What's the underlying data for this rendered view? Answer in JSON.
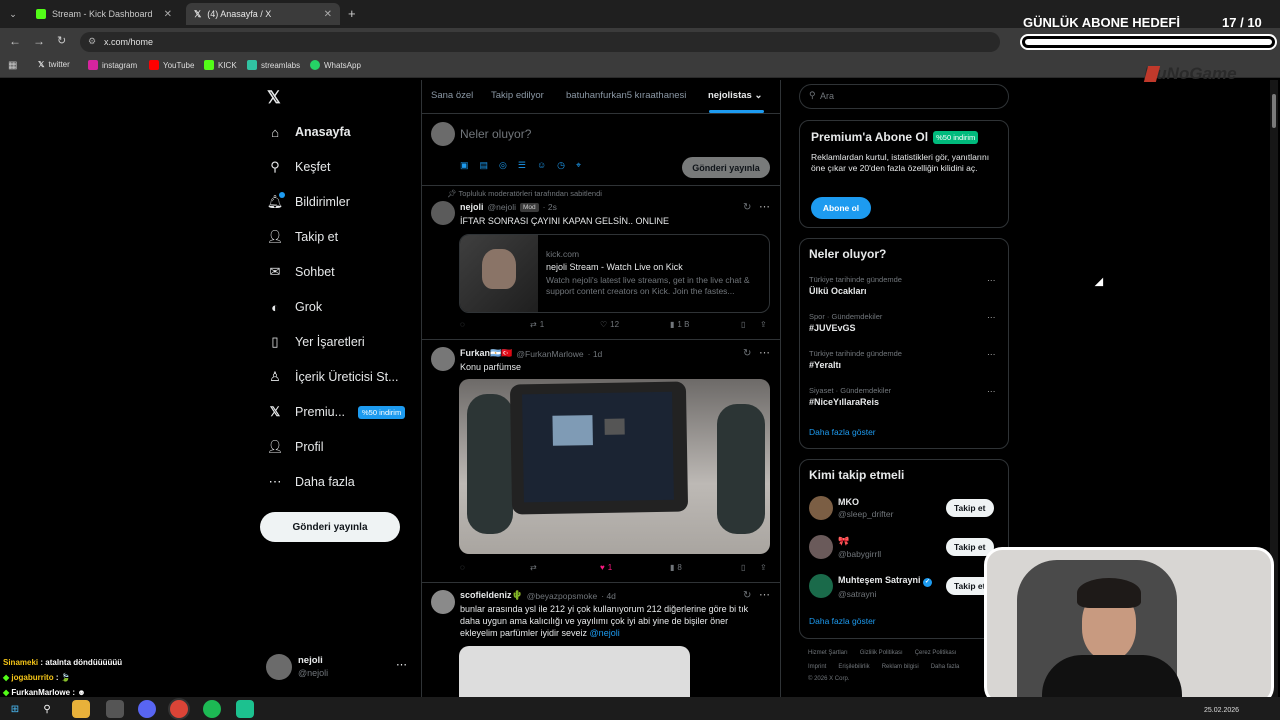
{
  "browser": {
    "tabs": [
      {
        "label": "Stream - Kick Dashboard"
      },
      {
        "label": "(4) Anasayfa / X"
      }
    ],
    "url": "x.com/home",
    "bookmarks": [
      "twitter",
      "instagram",
      "YouTube",
      "KICK",
      "streamlabs",
      "WhatsApp"
    ]
  },
  "overlay": {
    "goal_title": "GÜNLÜK ABONE HEDEFİ",
    "goal_current": "17",
    "goal_total": "/ 10",
    "brand": "BuNoGame"
  },
  "nav": {
    "items": [
      {
        "label": "Anasayfa",
        "icon": "home-icon"
      },
      {
        "label": "Keşfet",
        "icon": "search-icon"
      },
      {
        "label": "Bildirimler",
        "icon": "bell-icon"
      },
      {
        "label": "Takip et",
        "icon": "follow-icon"
      },
      {
        "label": "Sohbet",
        "icon": "mail-icon"
      },
      {
        "label": "Grok",
        "icon": "grok-icon"
      },
      {
        "label": "Yer İşaretleri",
        "icon": "bookmark-icon"
      },
      {
        "label": "İçerik Üreticisi St...",
        "icon": "creator-icon"
      },
      {
        "label": "Premiu...",
        "icon": "x-icon"
      },
      {
        "label": "Profil",
        "icon": "profile-icon"
      },
      {
        "label": "Daha fazla",
        "icon": "more-icon"
      }
    ],
    "premium_badge": "%50 indirim",
    "post_button": "Gönderi yayınla",
    "account_name": "nejoli",
    "account_handle": "@nejoli"
  },
  "feed": {
    "tabs": [
      "Sana özel",
      "Takip edilyor",
      "batuhanfurkan5 kıraathanesi",
      "nejolistas"
    ],
    "compose_placeholder": "Neler oluyor?",
    "compose_button": "Gönderi yayınla",
    "pinned_note": "Topluluk moderatörleri tarafından sabitlendi",
    "tweets": [
      {
        "name": "nejoli",
        "handle": "@nejoli",
        "badge": "Mod",
        "time": "· 2s",
        "text": "İFTAR SONRASI ÇAYINI KAPAN GELSİN.. ONLINE",
        "card_domain": "kick.com",
        "card_title": "nejoli Stream - Watch Live on Kick",
        "card_desc": "Watch nejoli's latest live streams, get in the live chat & support content creators on Kick. Join the fastes...",
        "retweets": "1",
        "likes": "12",
        "views": "1 B"
      },
      {
        "name": "Furkan🇦🇷🇹🇷",
        "handle": "@FurkanMarlowe",
        "time": "· 1d",
        "text": "Konu parfümse",
        "likes": "1",
        "views": "8"
      },
      {
        "name": "scofieldeniz🌵",
        "handle": "@beyazpopsmoke",
        "time": "· 4d",
        "text": "bunlar arasında ysl ile 212 yi çok kullanıyorum 212 diğerlerine göre bi tık daha uygun ama kalıcılığı ve yayılımı çok iyi abi yine de bişiler öner ekleyelim parfümler iyidir seveiz ",
        "mention": "@nejoli"
      }
    ]
  },
  "sidebar": {
    "search_placeholder": "Ara",
    "premium_title": "Premium'a Abone Ol",
    "premium_badge": "%50 indirim",
    "premium_text": "Reklamlardan kurtul, istatistikleri gör, yanıtlarını öne çıkar ve 20'den fazla özelliğin kilidini aç.",
    "premium_button": "Abone ol",
    "trends_title": "Neler oluyor?",
    "trends": [
      {
        "category": "Türkiye tarihinde gündemde",
        "topic": "Ülkü Ocakları"
      },
      {
        "category": "Spor · Gündemdekiler",
        "topic": "#JUVEvGS"
      },
      {
        "category": "Türkiye tarihinde gündemde",
        "topic": "#Yeraltı"
      },
      {
        "category": "Siyaset · Gündemdekiler",
        "topic": "#NiceYıllaraReis"
      }
    ],
    "trends_more": "Daha fazla göster",
    "who_title": "Kimi takip etmeli",
    "who": [
      {
        "name": "MKO",
        "handle": "@sleep_drifter",
        "button": "Takip et"
      },
      {
        "name": "🎀",
        "handle": "@babygirrll",
        "button": "Takip et"
      },
      {
        "name": "Muhteşem Satrayni",
        "handle": "@satrayni",
        "button": "Takip et"
      }
    ],
    "who_more": "Daha fazla göster",
    "footer1": [
      "Hizmet Şartları",
      "Gizlilik Politikası",
      "Çerez Politikası"
    ],
    "footer2": [
      "Imprint",
      "Erişilebilirlik",
      "Reklam bilgisi",
      "Daha fazla"
    ],
    "copyright": "© 2026 X Corp."
  },
  "chat": [
    {
      "user": "Sinameki",
      "text": ": atalnta döndüüüüüü",
      "color": "#f5c518"
    },
    {
      "user": "jogaburrito",
      "text": ": 🍃",
      "color": "#f5c518"
    },
    {
      "user": "FurkanMarlowe",
      "text": ": ☻",
      "color": "#ffffff"
    }
  ],
  "taskbar": {
    "date": "25.02.2026"
  }
}
